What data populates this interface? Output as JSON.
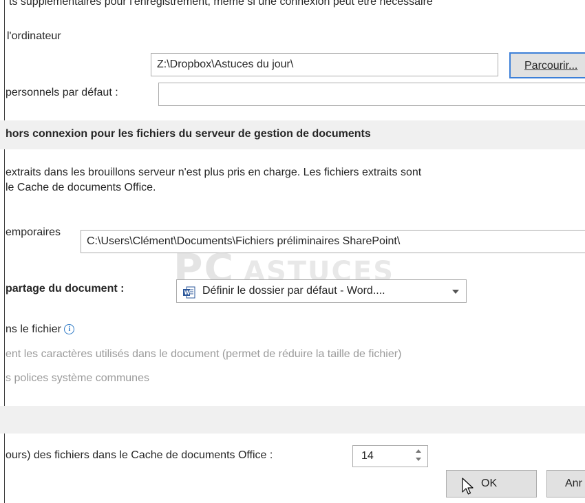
{
  "top_line": "ts supplémentaires pour l'enregistrement, même si une connexion peut être nécessaire",
  "computer_label": "l'ordinateur",
  "default_location": {
    "value": "Z:\\Dropbox\\Astuces du jour\\",
    "browse_button": "Parcourir..."
  },
  "personal_templates": {
    "label": "personnels par défaut :",
    "value": ""
  },
  "offline_section": {
    "title": "hors connexion pour les fichiers du serveur de gestion de documents",
    "description_line1": "extraits dans les brouillons serveur n'est plus pris en charge. Les fichiers extraits sont",
    "description_line2": "le Cache de documents Office."
  },
  "temp_files": {
    "label": "emporaires",
    "value": "C:\\Users\\Clément\\Documents\\Fichiers préliminaires SharePoint\\"
  },
  "watermark": "PCASTUCES",
  "sharing": {
    "label": "partage du document :",
    "combo_value": "Définir le dossier par défaut - Word...."
  },
  "embed_fonts": {
    "label": "ns le fichier",
    "option1": "ent les caractères utilisés dans le document (permet de réduire la taille de fichier)",
    "option2": "s polices système communes"
  },
  "cache": {
    "label": "ours) des fichiers dans le Cache de documents Office :",
    "value": "14"
  },
  "dialog_buttons": {
    "ok": "OK",
    "cancel": "Anr"
  },
  "colors": {
    "section_background": "#f0f0f0",
    "info_icon": "#2b78c5",
    "disabled_text": "#9a9a9a",
    "button_focus_border": "#3c7fd8"
  }
}
